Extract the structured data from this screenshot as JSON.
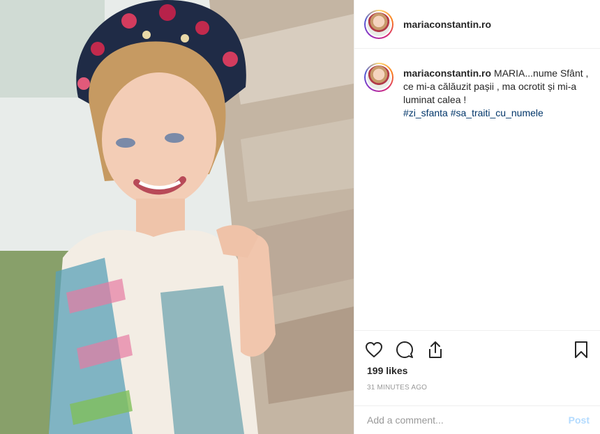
{
  "photo": {
    "alt_subject": ""
  },
  "header": {
    "username": "mariaconstantin.ro"
  },
  "caption": {
    "username": "mariaconstantin.ro",
    "text": "MARIA...nume Sfânt , ce mi-a călăuzit pașii , ma ocrotit și mi-a luminat calea !",
    "hashtags": [
      "#zi_sfanta",
      "#sa_traiti_cu_numele"
    ]
  },
  "actions": {
    "like_icon": "heart-icon",
    "comment_icon": "comment-bubble-icon",
    "share_icon": "share-icon",
    "save_icon": "bookmark-icon"
  },
  "stats": {
    "likes": "199 likes",
    "time": "31 MINUTES AGO"
  },
  "comment": {
    "placeholder": "Add a comment...",
    "post_label": "Post"
  },
  "colors": {
    "hashtag": "#003569",
    "post_disabled": "#b3dbff",
    "muted": "#999999",
    "border": "#efefef"
  }
}
